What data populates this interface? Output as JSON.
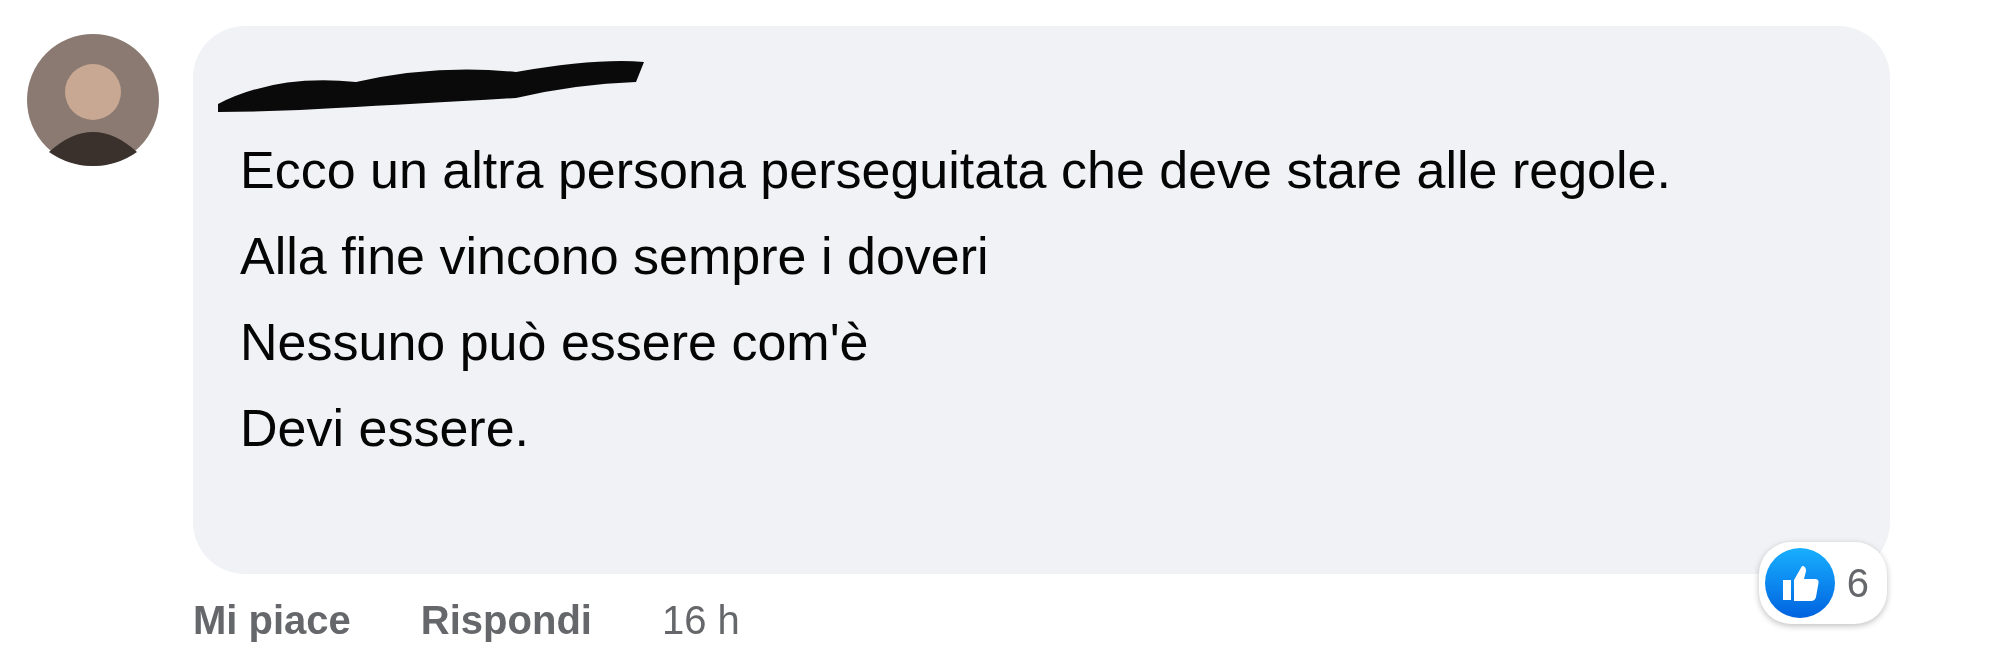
{
  "comment": {
    "paragraphs": [
      "Ecco un altra persona perseguitata che deve stare alle regole.",
      "Alla fine vincono sempre i doveri",
      "Nessuno può essere com'è",
      "Devi essere."
    ],
    "reactions": {
      "count": "6"
    }
  },
  "actions": [
    {
      "label": "Mi piace",
      "kind": "link"
    },
    {
      "label": "Rispondi",
      "kind": "link"
    },
    {
      "label": "16 h",
      "kind": "time"
    }
  ]
}
